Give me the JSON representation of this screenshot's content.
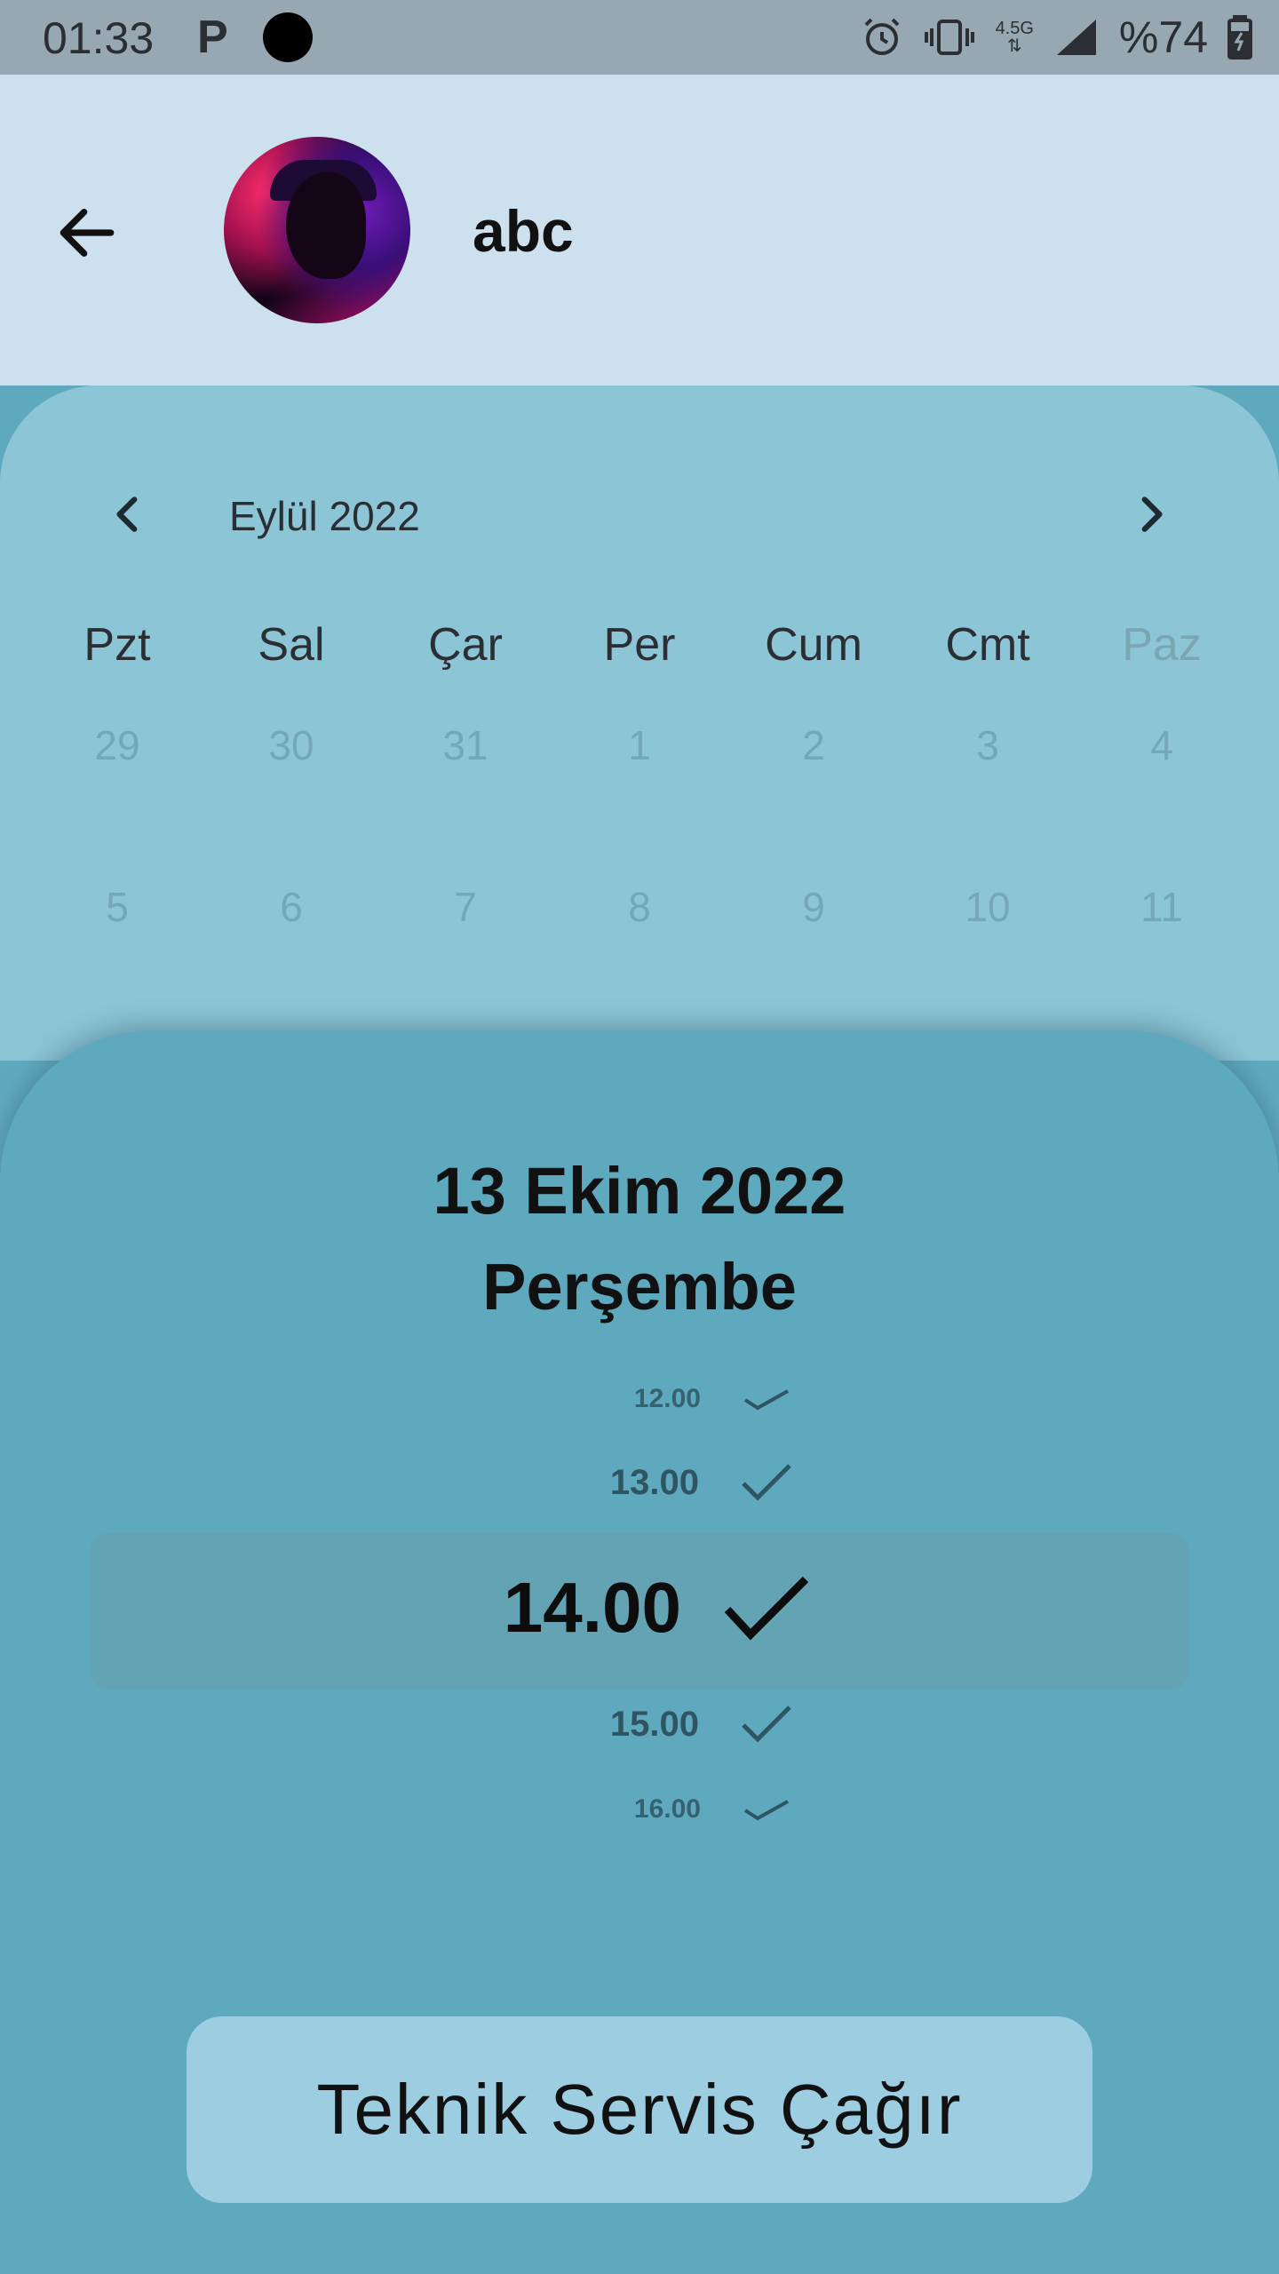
{
  "status_bar": {
    "time": "01:33",
    "network": "4.5G",
    "battery": "%74"
  },
  "profile": {
    "name": "abc"
  },
  "calendar": {
    "month": "Eylül 2022",
    "weekdays": [
      "Pzt",
      "Sal",
      "Çar",
      "Per",
      "Cum",
      "Cmt",
      "Paz"
    ],
    "weeks": [
      [
        "29",
        "30",
        "31",
        "1",
        "2",
        "3",
        "4"
      ],
      [
        "5",
        "6",
        "7",
        "8",
        "9",
        "10",
        "11"
      ]
    ]
  },
  "selection": {
    "date": "13 Ekim 2022",
    "day": "Perşembe",
    "times": [
      "12.00",
      "13.00",
      "14.00",
      "15.00",
      "16.00"
    ],
    "selected_time": "14.00"
  },
  "actions": {
    "call_service_label": "Teknik Servis Çağır"
  },
  "colors": {
    "header_bg": "#cde0ee",
    "calendar_bg": "#8cc5d6",
    "sheet_bg": "#5fa9bf",
    "button_bg": "#9dcde0"
  }
}
